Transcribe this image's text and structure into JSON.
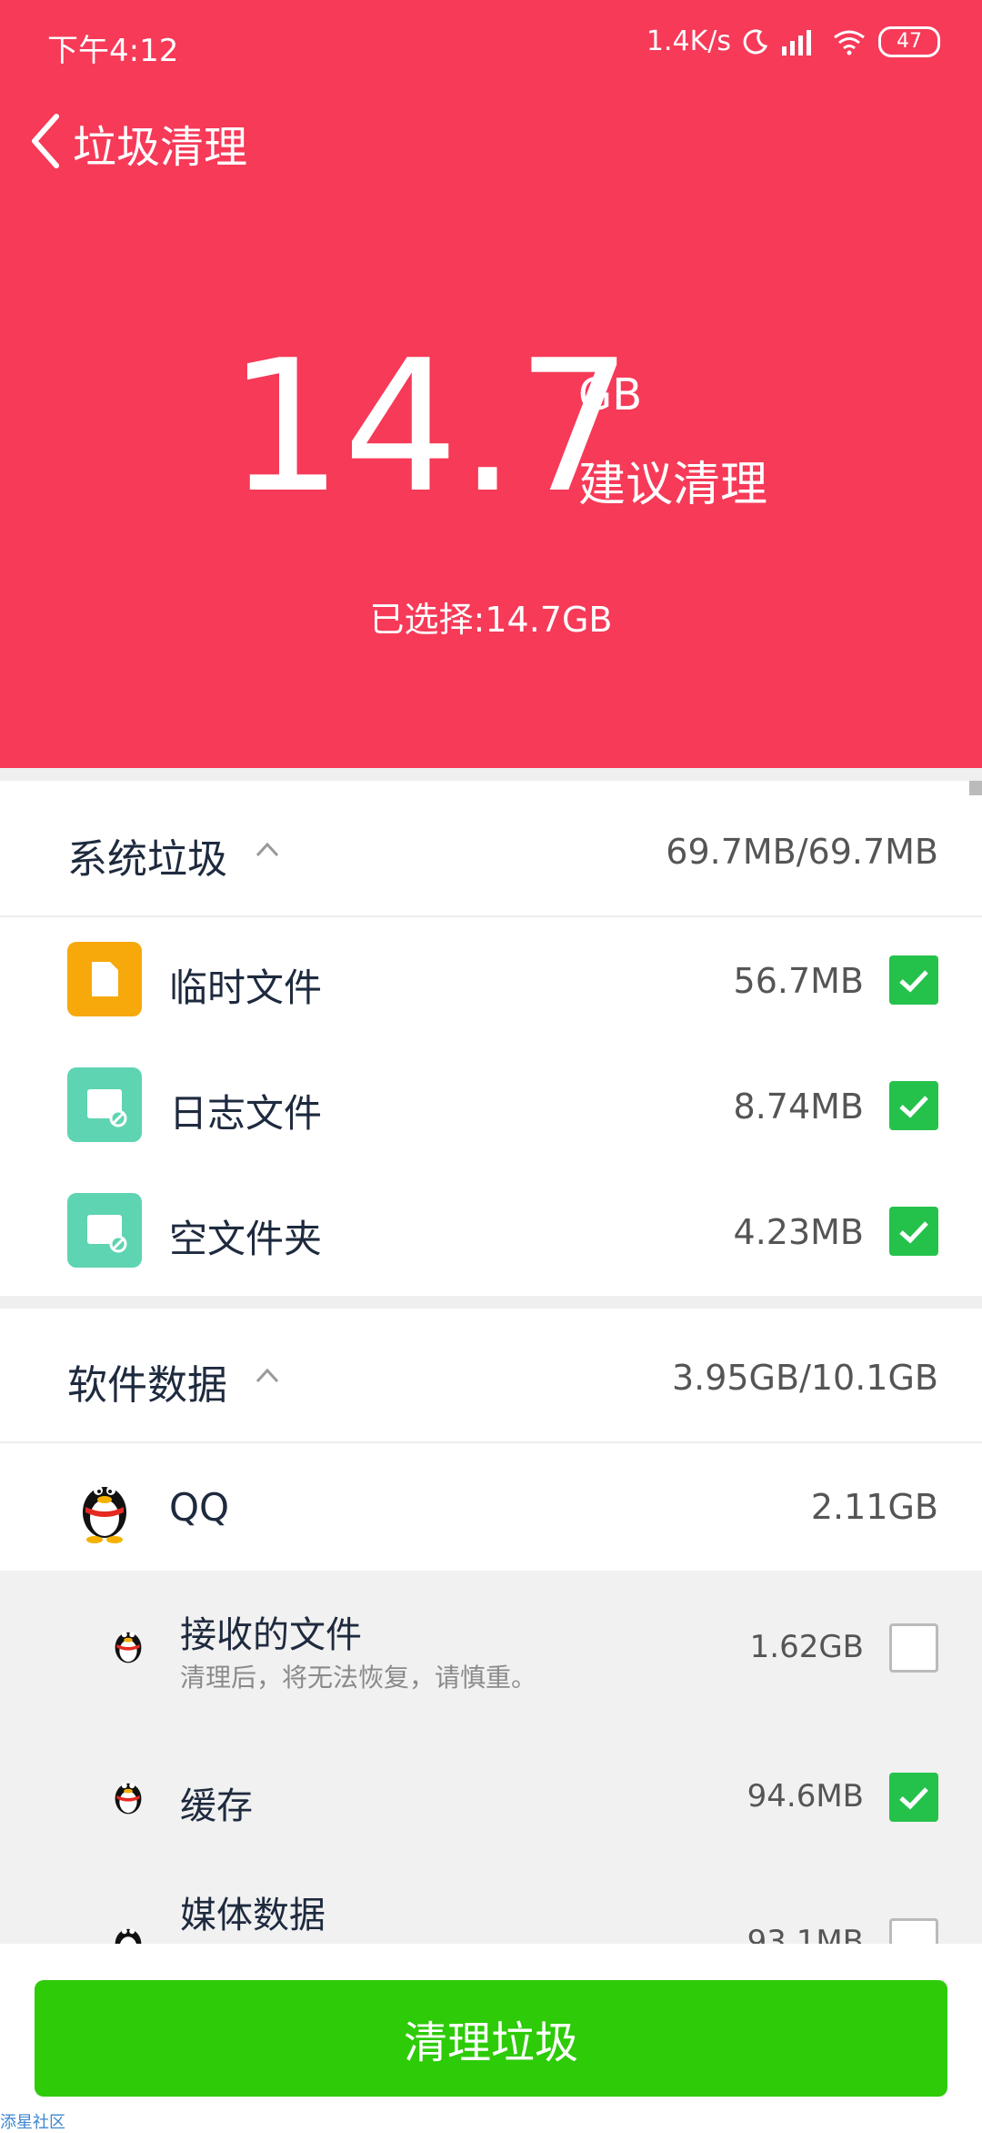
{
  "status": {
    "time": "下午4:12",
    "speed": "1.4K/s",
    "battery": "47"
  },
  "header": {
    "title": "垃圾清理",
    "size_value": "14.7",
    "size_unit": "GB",
    "suggest": "建议清理",
    "selected": "已选择:14.7GB"
  },
  "system": {
    "title": "系统垃圾",
    "size": "69.7MB/69.7MB",
    "items": [
      {
        "label": "临时文件",
        "size": "56.7MB",
        "checked": true
      },
      {
        "label": "日志文件",
        "size": "8.74MB",
        "checked": true
      },
      {
        "label": "空文件夹",
        "size": "4.23MB",
        "checked": true
      }
    ]
  },
  "software": {
    "title": "软件数据",
    "size": "3.95GB/10.1GB",
    "app": {
      "label": "QQ",
      "size": "2.11GB"
    },
    "subitems": [
      {
        "label": "接收的文件",
        "note": "清理后，将无法恢复，请慎重。",
        "size": "1.62GB",
        "checked": false
      },
      {
        "label": "缓存",
        "size": "94.6MB",
        "checked": true
      },
      {
        "label": "媒体数据",
        "size": "93.1MB",
        "checked": false
      }
    ]
  },
  "clean_button": "清理垃圾",
  "watermark": "添星社区",
  "colors": {
    "header": "#F63A58",
    "check": "#25C24B",
    "button": "#2DCB08"
  }
}
